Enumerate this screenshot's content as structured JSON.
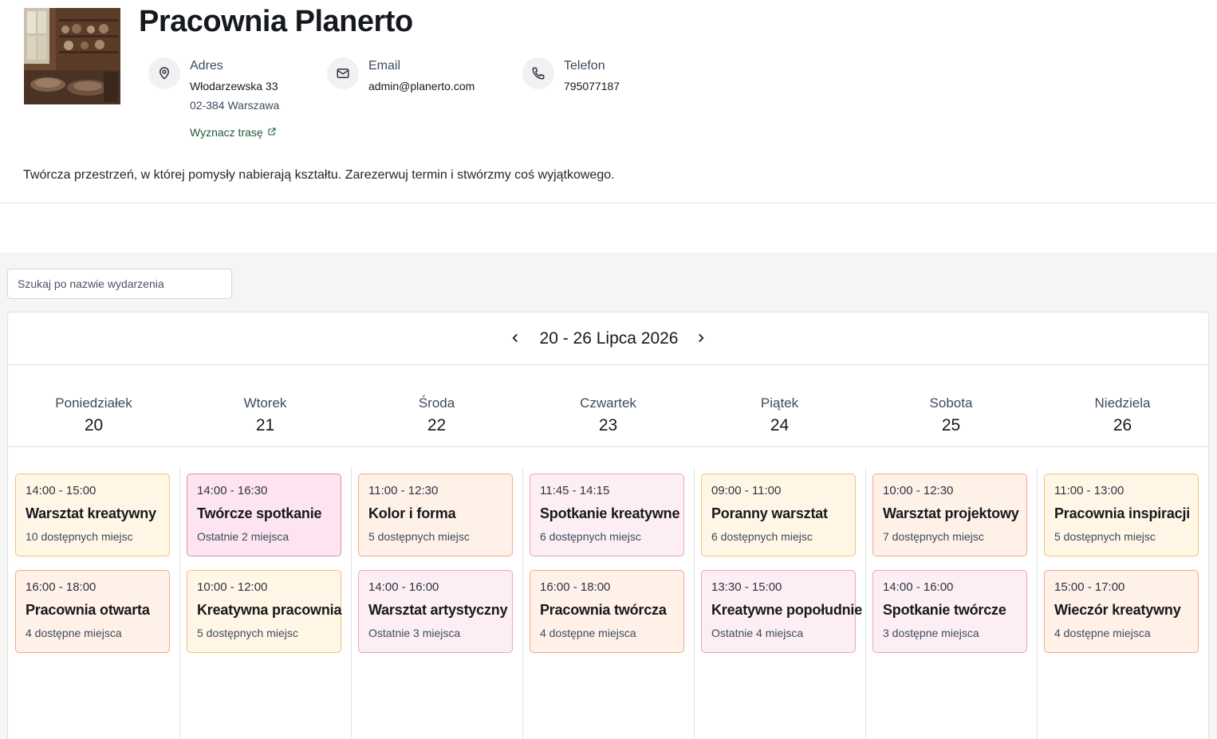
{
  "studio": {
    "name": "Pracownia Planerto",
    "description": "Twórcza przestrzeń, w której pomysły nabierają kształtu. Zarezerwuj termin i stwórzmy coś wyjątkowego."
  },
  "contact": {
    "address_label": "Adres",
    "address_line1": "Włodarzewska 33",
    "address_line2": "02-384 Warszawa",
    "route_link": "Wyznacz trasę",
    "email_label": "Email",
    "email_value": "admin@planerto.com",
    "phone_label": "Telefon",
    "phone_value": "795077187"
  },
  "search": {
    "placeholder": "Szukaj po nazwie wydarzenia"
  },
  "calendar": {
    "range_label": "20 - 26 Lipca 2026",
    "days": [
      {
        "name": "Poniedziałek",
        "num": "20"
      },
      {
        "name": "Wtorek",
        "num": "21"
      },
      {
        "name": "Środa",
        "num": "22"
      },
      {
        "name": "Czwartek",
        "num": "23"
      },
      {
        "name": "Piątek",
        "num": "24"
      },
      {
        "name": "Sobota",
        "num": "25"
      },
      {
        "name": "Niedziela",
        "num": "26"
      }
    ],
    "events": [
      [
        {
          "time": "14:00 - 15:00",
          "title": "Warsztat kreatywny",
          "seats": "10 dostępnych miejsc",
          "color": "yellow"
        },
        {
          "time": "16:00 - 18:00",
          "title": "Pracownia otwarta",
          "seats": "4 dostępne miejsca",
          "color": "orange"
        }
      ],
      [
        {
          "time": "14:00 - 16:30",
          "title": "Twórcze spotkanie",
          "seats": "Ostatnie 2 miejsca",
          "color": "pink"
        },
        {
          "time": "10:00 - 12:00",
          "title": "Kreatywna pracownia",
          "seats": "5 dostępnych miejsc",
          "color": "yellow"
        }
      ],
      [
        {
          "time": "11:00 - 12:30",
          "title": "Kolor i forma",
          "seats": "5 dostępnych miejsc",
          "color": "orange"
        },
        {
          "time": "14:00 - 16:00",
          "title": "Warsztat artystyczny",
          "seats": "Ostatnie 3 miejsca",
          "color": "lightpink"
        }
      ],
      [
        {
          "time": "11:45 - 14:15",
          "title": "Spotkanie kreatywne",
          "seats": "6 dostępnych miejsc",
          "color": "lightpink"
        },
        {
          "time": "16:00 - 18:00",
          "title": "Pracownia twórcza",
          "seats": "4 dostępne miejsca",
          "color": "orange"
        }
      ],
      [
        {
          "time": "09:00 - 11:00",
          "title": "Poranny warsztat",
          "seats": "6 dostępnych miejsc",
          "color": "yellow"
        },
        {
          "time": "13:30 - 15:00",
          "title": "Kreatywne popołudnie",
          "seats": "Ostatnie 4 miejsca",
          "color": "lightpink"
        }
      ],
      [
        {
          "time": "10:00 - 12:30",
          "title": "Warsztat projektowy",
          "seats": "7 dostępnych miejsc",
          "color": "orange"
        },
        {
          "time": "14:00 - 16:00",
          "title": "Spotkanie twórcze",
          "seats": "3 dostępne miejsca",
          "color": "lightpink"
        }
      ],
      [
        {
          "time": "11:00 - 13:00",
          "title": "Pracownia inspiracji",
          "seats": "5 dostępnych miejsc",
          "color": "yellow"
        },
        {
          "time": "15:00 - 17:00",
          "title": "Wieczór kreatywny",
          "seats": "4 dostępne miejsca",
          "color": "orange"
        }
      ]
    ]
  },
  "icons": {
    "location": "map-pin-icon",
    "email": "mail-icon",
    "phone": "phone-icon",
    "external": "external-link-icon",
    "prev": "chevron-left-icon",
    "next": "chevron-right-icon"
  },
  "colors": {
    "link": "#1e5a37",
    "background_main": "#f5f5f4"
  }
}
